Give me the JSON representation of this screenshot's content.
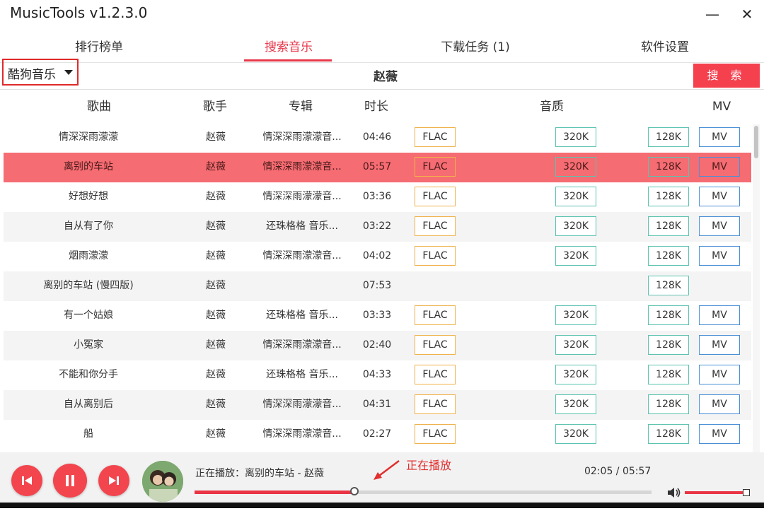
{
  "app": {
    "title": "MusicTools v1.2.3.0",
    "minimize_icon": "minimize-icon",
    "close_icon": "close-icon"
  },
  "tabs": [
    {
      "label": "排行榜单",
      "active": false
    },
    {
      "label": "搜索音乐",
      "active": true
    },
    {
      "label": "下载任务 (1)",
      "active": false
    },
    {
      "label": "软件设置",
      "active": false
    }
  ],
  "search": {
    "source": "酷狗音乐",
    "query": "赵薇",
    "button_label": "搜 索"
  },
  "columns": {
    "song": "歌曲",
    "artist": "歌手",
    "album": "专辑",
    "duration": "时长",
    "quality": "音质",
    "mv": "MV"
  },
  "quality_labels": {
    "flac": "FLAC",
    "k320": "320K",
    "k128": "128K",
    "mv": "MV"
  },
  "rows": [
    {
      "song": "情深深雨濛濛",
      "artist": "赵薇",
      "album": "情深深雨濛濛音...",
      "duration": "04:46",
      "flac": true,
      "k320": true,
      "k128": true,
      "mv": true,
      "selected": false
    },
    {
      "song": "离别的车站",
      "artist": "赵薇",
      "album": "情深深雨濛濛音...",
      "duration": "05:57",
      "flac": true,
      "k320": true,
      "k128": true,
      "mv": true,
      "selected": true
    },
    {
      "song": "好想好想",
      "artist": "赵薇",
      "album": "情深深雨濛濛音...",
      "duration": "03:36",
      "flac": true,
      "k320": true,
      "k128": true,
      "mv": true,
      "selected": false
    },
    {
      "song": "自从有了你",
      "artist": "赵薇",
      "album": "还珠格格 音乐...",
      "duration": "03:22",
      "flac": true,
      "k320": true,
      "k128": true,
      "mv": true,
      "selected": false
    },
    {
      "song": "烟雨濛濛",
      "artist": "赵薇",
      "album": "情深深雨濛濛音...",
      "duration": "04:02",
      "flac": true,
      "k320": true,
      "k128": true,
      "mv": true,
      "selected": false
    },
    {
      "song": "离别的车站 (慢四版)",
      "artist": "赵薇",
      "album": "",
      "duration": "07:53",
      "flac": false,
      "k320": false,
      "k128": true,
      "mv": false,
      "selected": false
    },
    {
      "song": "有一个姑娘",
      "artist": "赵薇",
      "album": "还珠格格 音乐...",
      "duration": "03:33",
      "flac": true,
      "k320": true,
      "k128": true,
      "mv": true,
      "selected": false
    },
    {
      "song": "小冤家",
      "artist": "赵薇",
      "album": "情深深雨濛濛音...",
      "duration": "02:40",
      "flac": true,
      "k320": true,
      "k128": true,
      "mv": true,
      "selected": false
    },
    {
      "song": "不能和你分手",
      "artist": "赵薇",
      "album": "还珠格格 音乐...",
      "duration": "04:33",
      "flac": true,
      "k320": true,
      "k128": true,
      "mv": true,
      "selected": false
    },
    {
      "song": "自从离别后",
      "artist": "赵薇",
      "album": "情深深雨濛濛音...",
      "duration": "04:31",
      "flac": true,
      "k320": true,
      "k128": true,
      "mv": true,
      "selected": false
    },
    {
      "song": "船",
      "artist": "赵薇",
      "album": "情深深雨濛濛音...",
      "duration": "02:27",
      "flac": true,
      "k320": true,
      "k128": true,
      "mv": true,
      "selected": false
    }
  ],
  "player": {
    "now_playing": "正在播放：离别的车站 - 赵薇",
    "annotation": "正在播放",
    "time": "02:05 / 05:57",
    "progress": 0.35,
    "volume": 0.95,
    "controls": [
      "prev-icon",
      "pause-icon",
      "next-icon"
    ]
  },
  "colors": {
    "accent": "#e8384a",
    "row_selected": "#f56c72",
    "flac_border": "#f0b24a",
    "kbps_border": "#5cc3b0",
    "mv_border": "#4a8fd6",
    "annotation": "#e22e2e"
  }
}
